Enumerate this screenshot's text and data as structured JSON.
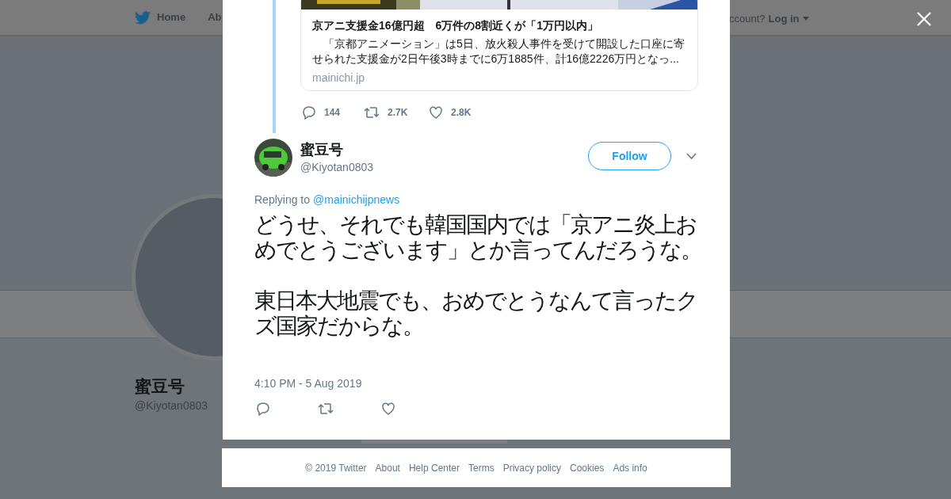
{
  "background_page": {
    "nav": {
      "home": "Home",
      "about": "Ab",
      "account_prompt": "ccount?",
      "login": "Log in"
    },
    "profile": {
      "name": "蜜豆号",
      "handle": "@Kiyotan0803"
    }
  },
  "modal": {
    "link_card": {
      "title": "京アニ支援金16億円超　6万件の8割近くが「1万円以内」",
      "description": "　「京都アニメーション」は5日、放火殺人事件を受けて開設した口座に寄せられた支援金が2日午後3時までに6万1885件、計16億2226万円となっ...",
      "domain": "mainichi.jp"
    },
    "parent_actions": {
      "replies": "144",
      "retweets": "2.7K",
      "likes": "2.8K"
    },
    "tweet": {
      "name": "蜜豆号",
      "handle": "@Kiyotan0803",
      "follow": "Follow",
      "replying_label": "Replying to",
      "replying_handle": "@mainichijpnews",
      "paragraphs": [
        "どうせ、それでも韓国国内では「京アニ炎上おめでとうございます」とか言ってんだろうな。",
        "東日本大地震でも、おめでとうなんて言ったクズ国家だからな。"
      ],
      "timestamp": "4:10 PM - 5 Aug 2019"
    }
  },
  "footer": [
    "© 2019 Twitter",
    "About",
    "Help Center",
    "Terms",
    "Privacy policy",
    "Cookies",
    "Ads info"
  ]
}
